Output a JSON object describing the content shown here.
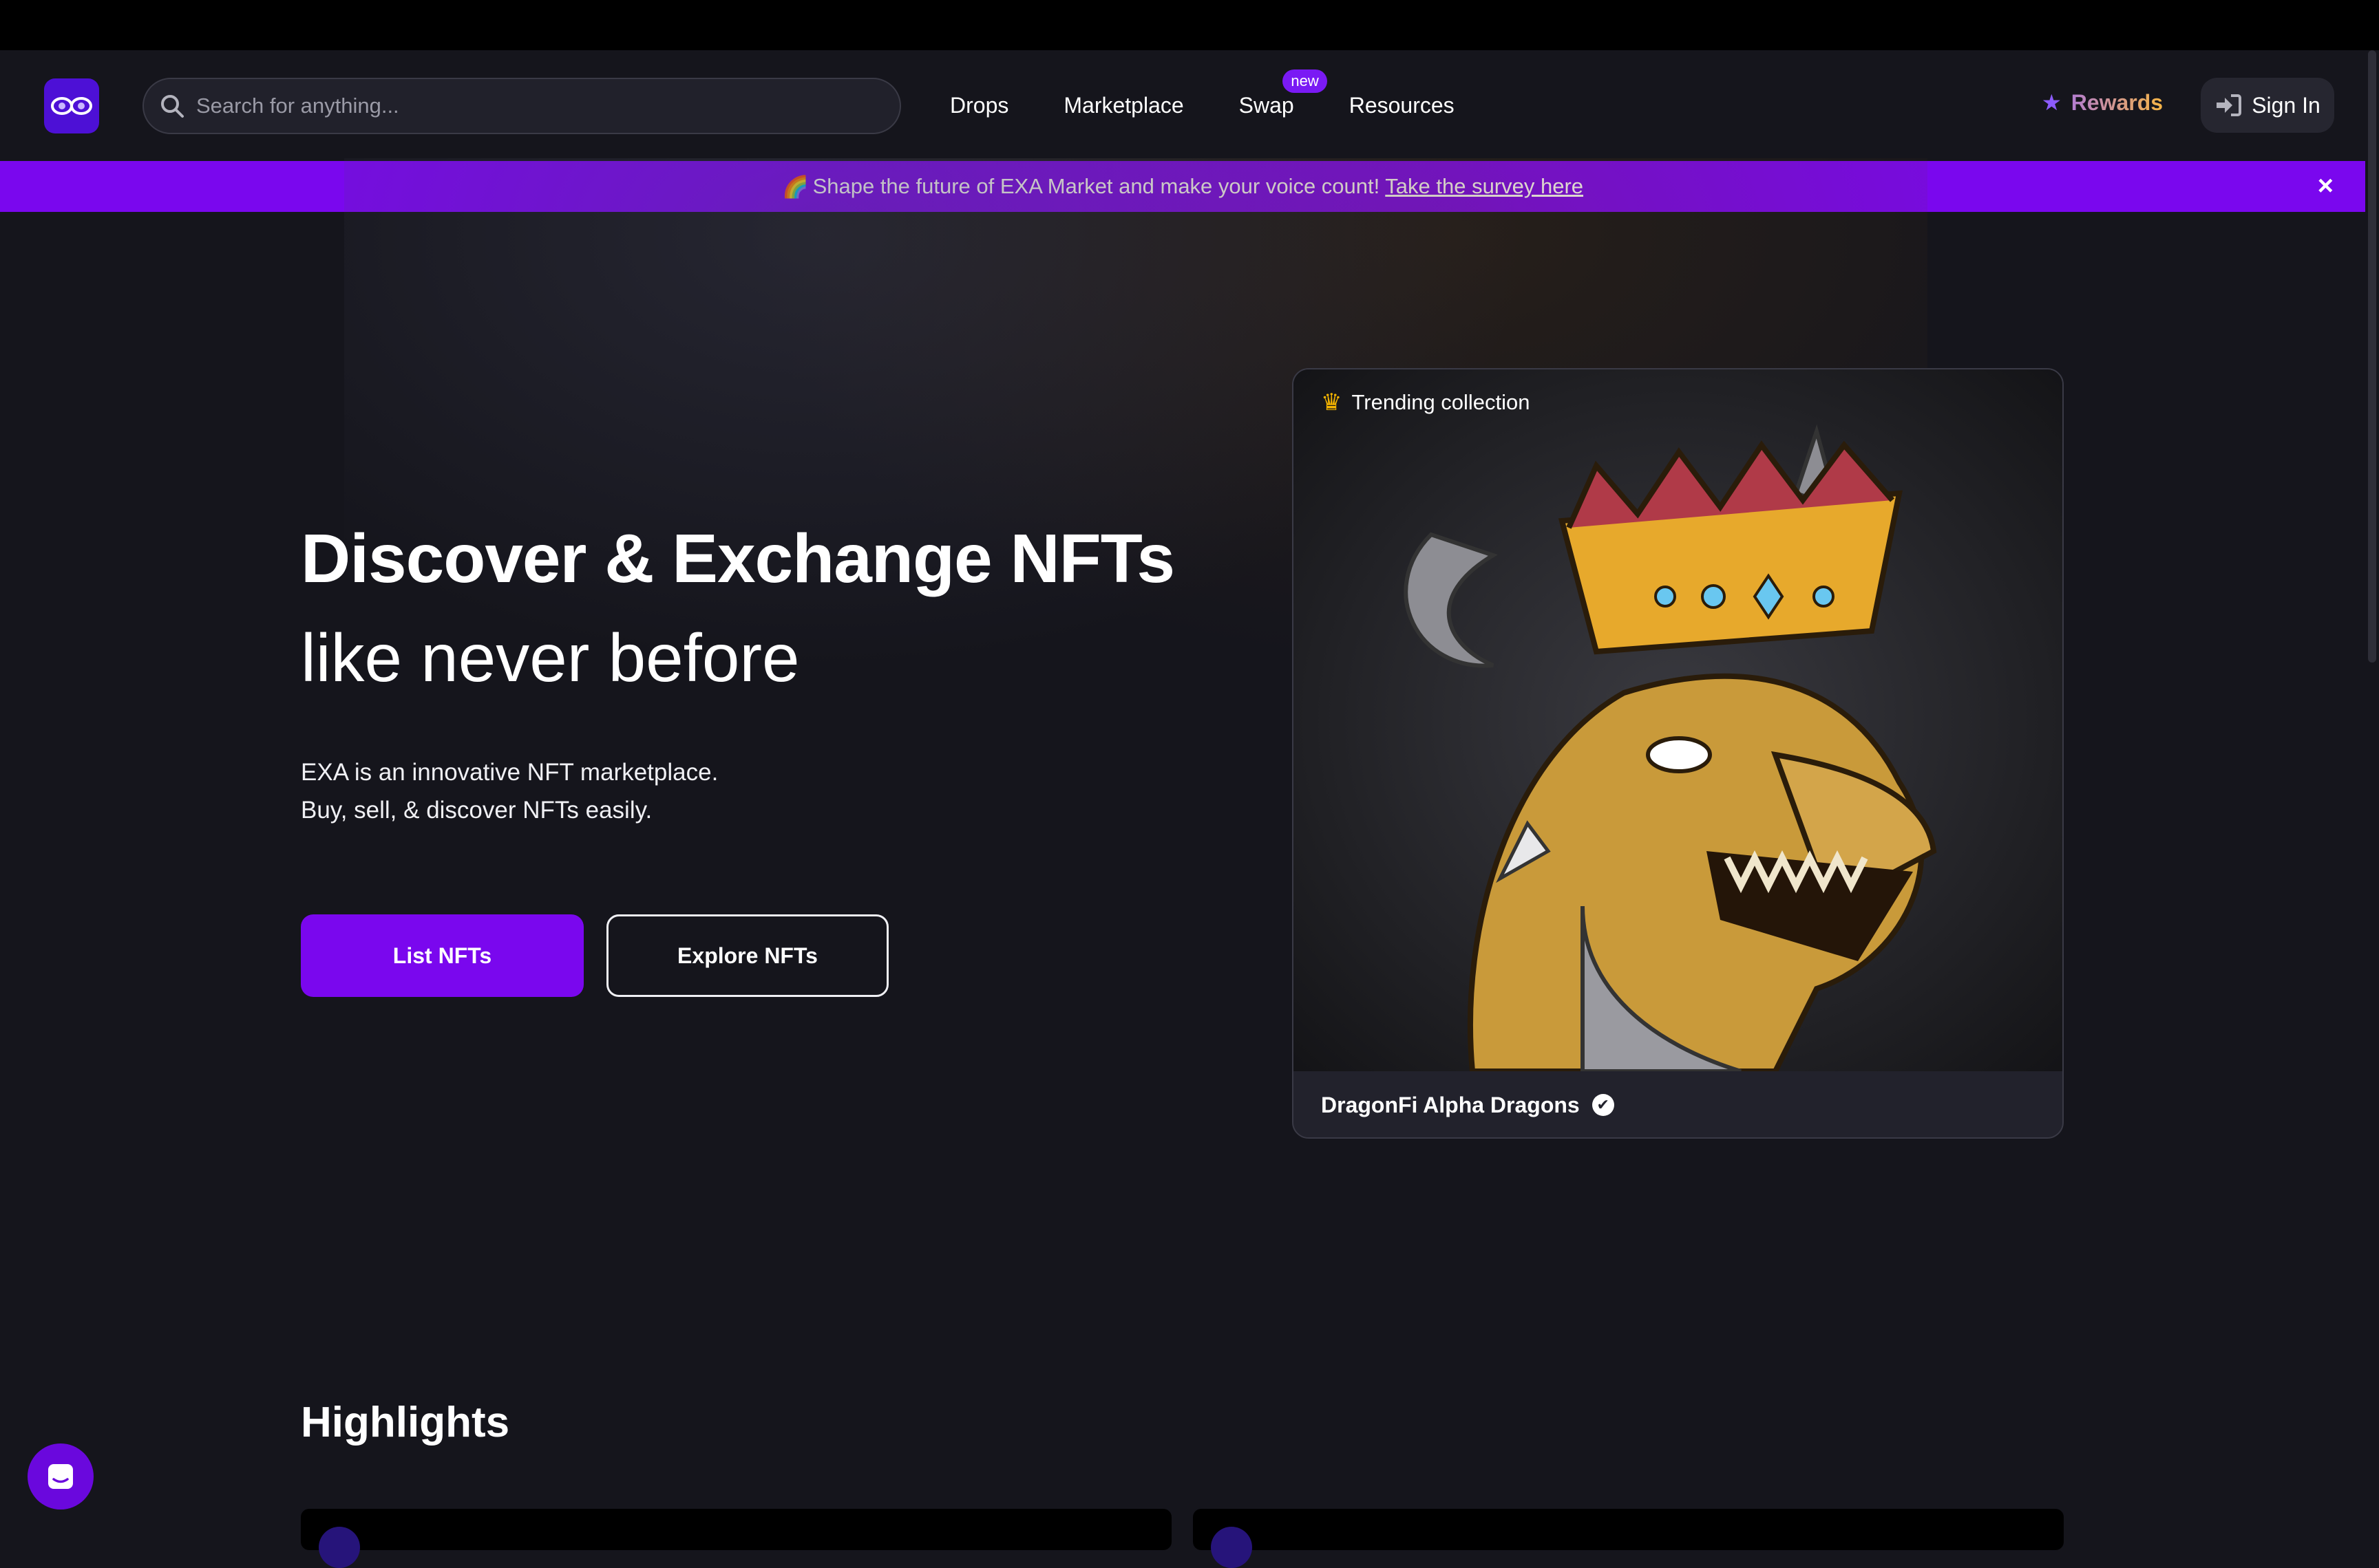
{
  "header": {
    "search_placeholder": "Search for anything...",
    "nav": [
      {
        "label": "Drops"
      },
      {
        "label": "Marketplace"
      },
      {
        "label": "Swap",
        "badge": "new"
      },
      {
        "label": "Resources"
      }
    ],
    "rewards_label": "Rewards",
    "signin_label": "Sign In"
  },
  "banner": {
    "emoji": "🌈",
    "text": "Shape the future of EXA Market and make your voice count!",
    "link": "Take the survey here",
    "close": "×"
  },
  "hero": {
    "title_line1": "Discover & Exchange NFTs",
    "title_line2": "like never before",
    "desc_line1": "EXA is an innovative NFT marketplace.",
    "desc_line2": "Buy, sell, & discover NFTs easily.",
    "primary_cta": "List NFTs",
    "secondary_cta": "Explore NFTs"
  },
  "trending": {
    "tag": "Trending collection",
    "collection_name": "DragonFi Alpha Dragons",
    "verified_icon": "check-circle-icon"
  },
  "highlights": {
    "title": "Highlights"
  },
  "colors": {
    "accent": "#7a07ee",
    "background": "#15151c",
    "rewards_gradient_start": "#9d6bff",
    "rewards_gradient_end": "#f6b545"
  }
}
